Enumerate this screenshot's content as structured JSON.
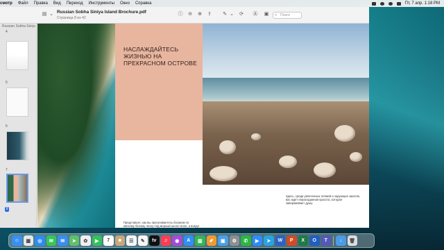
{
  "menubar": {
    "app_name": "смотр",
    "items": [
      "Файл",
      "Правка",
      "Вид",
      "Переход",
      "Инструменты",
      "Окно",
      "Справка"
    ],
    "clock": "Пт, 7 апр.  1:18 PM"
  },
  "document": {
    "title": "Russian Sobha Siniya Island Brochure.pdf",
    "subtitle": "Страница 8 из 42",
    "search_placeholder": "Поиск"
  },
  "sidebar": {
    "header": "Russian Sobha Siniya Isl...",
    "page_numbers": [
      "4",
      "5",
      "6",
      "7",
      "8"
    ],
    "selected_page": "8"
  },
  "page": {
    "headline": "НАСЛАЖДАЙТЕСЬ ЖИЗНЬЮ НА ПРЕКРАСНОМ ОСТРОВЕ",
    "caption": "Здесь, среди увлеченных пляжей и чарующих закатов, вас ждет неразгаданная красота, которая завораживает душу.",
    "paragraph": "Представьте, как вы прогуливаетесь босиком по мягкому белому песку под мерный шепот волн, а вокруг открываются потрясающие виды"
  },
  "dock": {
    "icons": [
      {
        "name": "finder-icon",
        "color": "#3b8ff0",
        "glyph": "☺"
      },
      {
        "name": "launchpad-icon",
        "color": "#e7e7ea",
        "glyph": "▦"
      },
      {
        "name": "safari-icon",
        "color": "#2d8cf0",
        "glyph": "◎"
      },
      {
        "name": "messages-icon",
        "color": "#34c759",
        "glyph": "✉"
      },
      {
        "name": "mail-icon",
        "color": "#3a8ef0",
        "glyph": "✉"
      },
      {
        "name": "maps-icon",
        "color": "#5fbf6a",
        "glyph": "➤"
      },
      {
        "name": "photos-icon",
        "color": "#f0f0f0",
        "glyph": "✿"
      },
      {
        "name": "facetime-icon",
        "color": "#33c15a",
        "glyph": "▶"
      },
      {
        "name": "calendar-icon",
        "color": "#ffffff",
        "glyph": "7"
      },
      {
        "name": "contacts-icon",
        "color": "#c9a77a",
        "glyph": "☻"
      },
      {
        "name": "reminders-icon",
        "color": "#f5f5f5",
        "glyph": "☰"
      },
      {
        "name": "freeform-icon",
        "color": "#f7f7f7",
        "glyph": "✎"
      },
      {
        "name": "appletv-icon",
        "color": "#111111",
        "glyph": "tv"
      },
      {
        "name": "music-icon",
        "color": "#fa3d55",
        "glyph": "♫"
      },
      {
        "name": "podcasts-icon",
        "color": "#a34bd8",
        "glyph": "◉"
      },
      {
        "name": "appstore-icon",
        "color": "#2f8ff5",
        "glyph": "A"
      },
      {
        "name": "numbers-icon",
        "color": "#35b552",
        "glyph": "▥"
      },
      {
        "name": "pages-icon",
        "color": "#f29a30",
        "glyph": "✐"
      },
      {
        "name": "preview-icon",
        "color": "#4aa0e8",
        "glyph": "▣"
      },
      {
        "name": "settings-icon",
        "color": "#8e8e93",
        "glyph": "⚙"
      },
      {
        "name": "whatsapp-icon",
        "color": "#2bb741",
        "glyph": "✆"
      },
      {
        "name": "zoom-icon",
        "color": "#2d8cff",
        "glyph": "▶"
      },
      {
        "name": "telegram-icon",
        "color": "#2aa3e0",
        "glyph": "➤"
      },
      {
        "name": "word-icon",
        "color": "#2b62c4",
        "glyph": "W"
      },
      {
        "name": "powerpoint-icon",
        "color": "#d04b25",
        "glyph": "P"
      },
      {
        "name": "excel-icon",
        "color": "#1f7a45",
        "glyph": "X"
      },
      {
        "name": "outlook-icon",
        "color": "#1f5fbf",
        "glyph": "O"
      },
      {
        "name": "teams-icon",
        "color": "#5458b8",
        "glyph": "T"
      },
      {
        "name": "downloads-icon",
        "color": "#4b9be6",
        "glyph": "↓"
      },
      {
        "name": "trash-icon",
        "color": "#d9dde2",
        "glyph": "🗑"
      }
    ]
  }
}
